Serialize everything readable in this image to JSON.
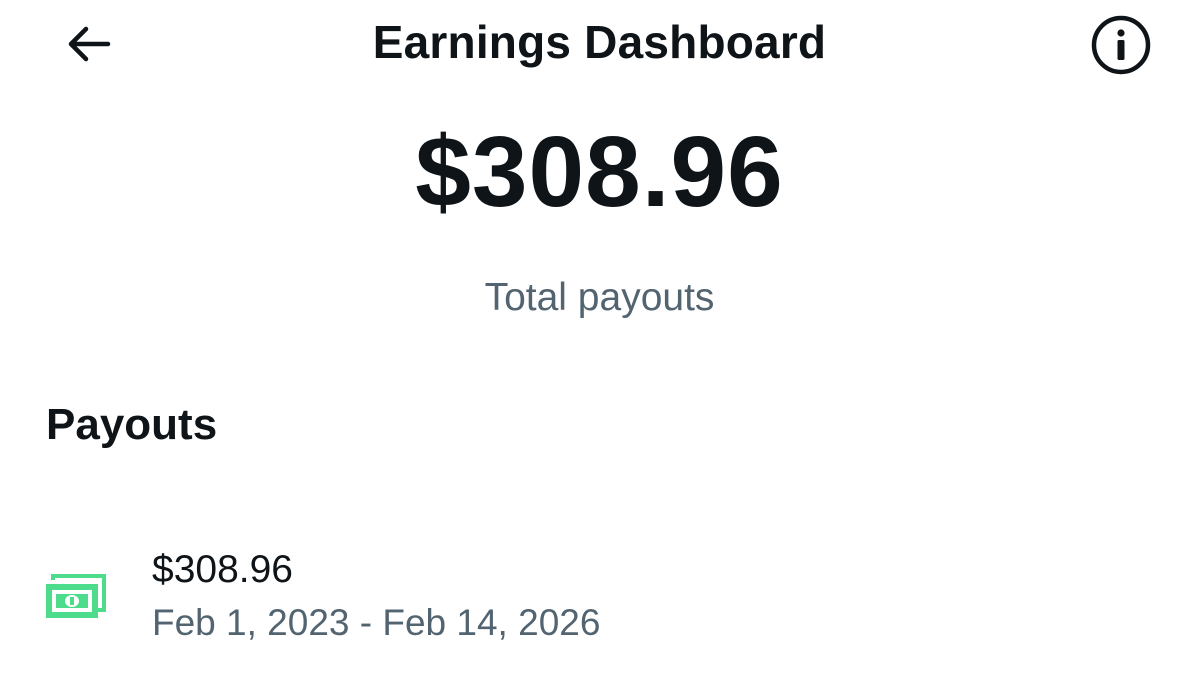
{
  "header": {
    "title": "Earnings Dashboard",
    "back_icon": "arrow-left-icon",
    "info_icon": "info-circle-icon"
  },
  "summary": {
    "amount": "$308.96",
    "label": "Total payouts"
  },
  "payouts": {
    "title": "Payouts",
    "items": [
      {
        "icon": "money-bills-icon",
        "amount": "$308.96",
        "date_range": "Feb 1, 2023 - Feb 14, 2026"
      }
    ]
  },
  "colors": {
    "text_primary": "#0f1419",
    "text_secondary": "#536471",
    "money_icon": "#4cdc8b",
    "background": "#ffffff"
  }
}
